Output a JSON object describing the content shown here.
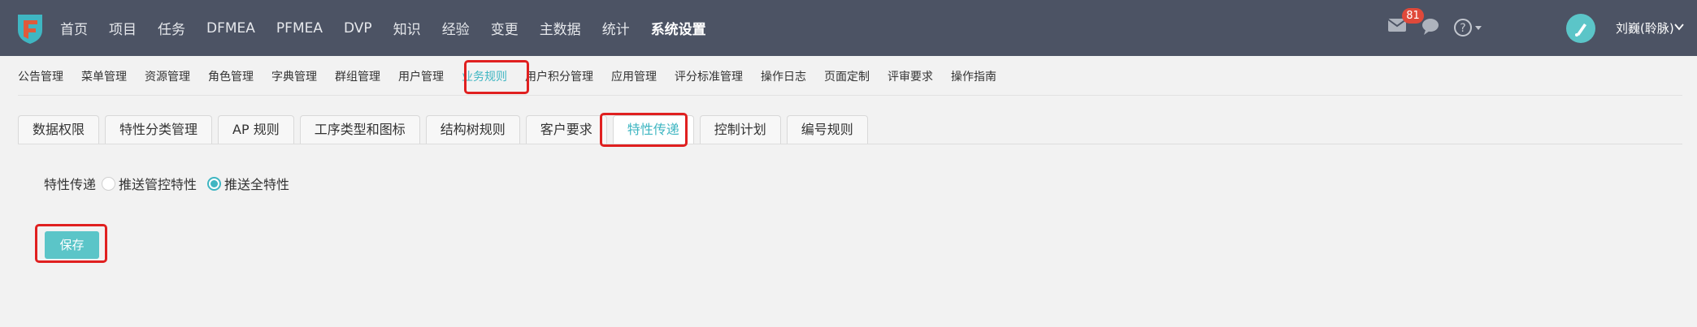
{
  "colors": {
    "topbar_bg": "#4c5364",
    "accent": "#3fb6c2",
    "button_bg": "#5bc5c8",
    "badge_bg": "#e0493a",
    "highlight_border": "#e02020"
  },
  "topbar": {
    "logo_icon": "app-logo-icon",
    "nav": [
      "首页",
      "项目",
      "任务",
      "DFMEA",
      "PFMEA",
      "DVP",
      "知识",
      "经验",
      "变更",
      "主数据",
      "统计",
      "系统设置"
    ],
    "active_nav": "系统设置",
    "mail_badge": "81",
    "icons": [
      "mail-icon",
      "chat-icon",
      "help-icon",
      "avatar"
    ],
    "username": "刘巍(聆脉)"
  },
  "subnav": {
    "items": [
      "公告管理",
      "菜单管理",
      "资源管理",
      "角色管理",
      "字典管理",
      "群组管理",
      "用户管理",
      "业务规则",
      "用户积分管理",
      "应用管理",
      "评分标准管理",
      "操作日志",
      "页面定制",
      "评审要求",
      "操作指南"
    ],
    "active": "业务规则"
  },
  "tabs": {
    "items": [
      "数据权限",
      "特性分类管理",
      "AP 规则",
      "工序类型和图标",
      "结构树规则",
      "客户要求",
      "特性传递",
      "控制计划",
      "编号规则"
    ],
    "active": "特性传递"
  },
  "form": {
    "label": "特性传递",
    "options": [
      {
        "label": "推送管控特性",
        "checked": false
      },
      {
        "label": "推送全特性",
        "checked": true
      }
    ],
    "save_label": "保存"
  }
}
